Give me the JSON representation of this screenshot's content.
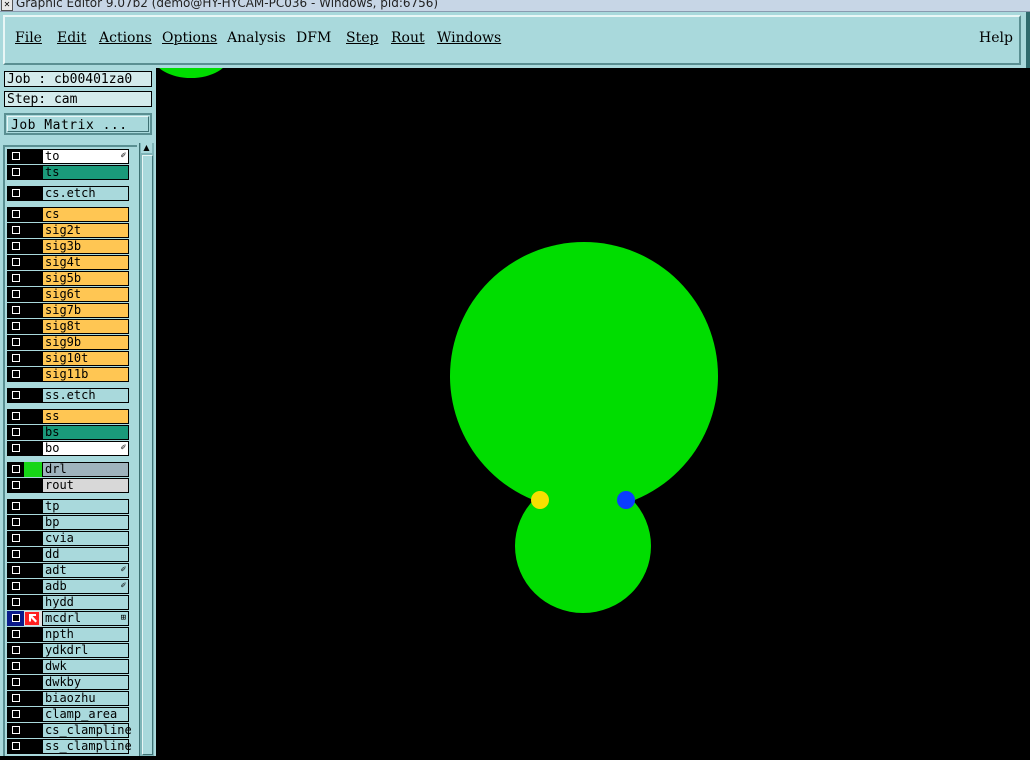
{
  "window": {
    "title": "Graphic Editor 9.07b2 (demo@HY-HYCAM-PC036 - Windows, pid:6756)"
  },
  "menu": {
    "items": [
      "File",
      "Edit",
      "Actions",
      "Options",
      "Analysis",
      "DFM",
      "Step",
      "Rout",
      "Windows"
    ],
    "help": "Help"
  },
  "job": {
    "job_line": "Job : cb00401za0",
    "step_line": "Step: cam",
    "matrix_button": "Job Matrix ..."
  },
  "layers": [
    {
      "name": "to",
      "color": "white",
      "tag": "✐"
    },
    {
      "name": "ts",
      "color": "teal"
    },
    {
      "name": "cs.etch",
      "color": "board"
    },
    {
      "name": "cs",
      "color": "orange"
    },
    {
      "name": "sig2t",
      "color": "orange"
    },
    {
      "name": "sig3b",
      "color": "orange"
    },
    {
      "name": "sig4t",
      "color": "orange"
    },
    {
      "name": "sig5b",
      "color": "orange"
    },
    {
      "name": "sig6t",
      "color": "orange"
    },
    {
      "name": "sig7b",
      "color": "orange"
    },
    {
      "name": "sig8t",
      "color": "orange"
    },
    {
      "name": "sig9b",
      "color": "orange"
    },
    {
      "name": "sig10t",
      "color": "orange"
    },
    {
      "name": "sig11b",
      "color": "orange"
    },
    {
      "name": "ss.etch",
      "color": "board"
    },
    {
      "name": "ss",
      "color": "orange"
    },
    {
      "name": "bs",
      "color": "teal"
    },
    {
      "name": "bo",
      "color": "white",
      "tag": "✐"
    },
    {
      "name": "drl",
      "color": "gray",
      "mark": "green"
    },
    {
      "name": "rout",
      "color": "lightgray"
    },
    {
      "name": "tp",
      "color": "board"
    },
    {
      "name": "bp",
      "color": "board"
    },
    {
      "name": "cvia",
      "color": "board"
    },
    {
      "name": "dd",
      "color": "board"
    },
    {
      "name": "adt",
      "color": "board",
      "tag": "✐"
    },
    {
      "name": "adb",
      "color": "board",
      "tag": "✐"
    },
    {
      "name": "hydd",
      "color": "board"
    },
    {
      "name": "mcdrl",
      "color": "board",
      "mark": "cursor",
      "active": true,
      "tag": "⊞"
    },
    {
      "name": "npth",
      "color": "board"
    },
    {
      "name": "ydkdrl",
      "color": "board"
    },
    {
      "name": "dwk",
      "color": "board"
    },
    {
      "name": "dwkby",
      "color": "board"
    },
    {
      "name": "biaozhu",
      "color": "board"
    },
    {
      "name": "clamp_area",
      "color": "board"
    },
    {
      "name": "cs_clampline",
      "color": "board"
    },
    {
      "name": "ss_clampline",
      "color": "board"
    }
  ],
  "colors": {
    "panel": "#a9d9dc",
    "pad": "#00dd00",
    "marker_yellow": "#f5e000",
    "marker_blue": "#0a3cff"
  },
  "icons": {
    "cursor": "arrow-cursor-icon",
    "edit": "pencil-icon"
  }
}
